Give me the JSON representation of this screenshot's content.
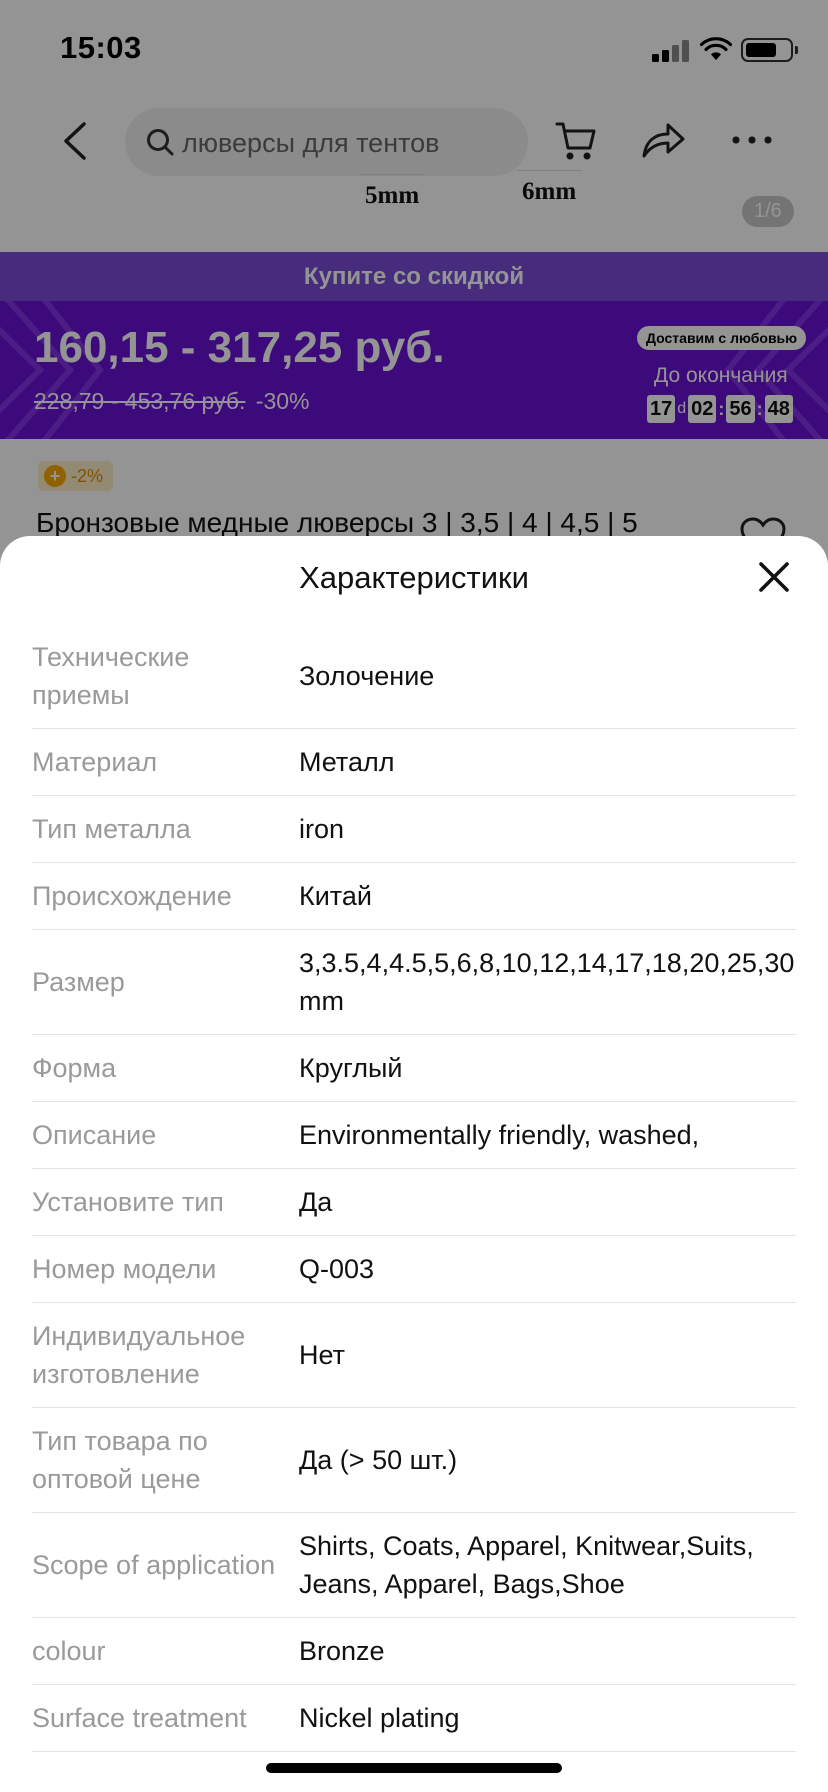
{
  "status_bar": {
    "time": "15:03",
    "battery_level": 0.72
  },
  "nav": {
    "search_text": "люверсы для тентов"
  },
  "gallery": {
    "size_labels": [
      "5mm",
      "6mm"
    ],
    "counter": "1/6"
  },
  "promo": {
    "banner": "Купите со скидкой",
    "price_range": "160,15 - 317,25 руб.",
    "old_price": "228,79 - 453,76 руб.",
    "discount": "-30%",
    "badge": "Доставим с любовью",
    "ends_label": "До окончания",
    "timer": {
      "days": "17",
      "days_unit": "d",
      "hours": "02",
      "minutes": "56",
      "seconds": "48"
    },
    "background_color": "#6a12d6",
    "strip_color": "#7b4bd8"
  },
  "product": {
    "coin_badge": "-2%",
    "title": "Бронзовые медные люверсы 3 | 3,5 | 4 | 4,5 | 5"
  },
  "sheet": {
    "title": "Характеристики",
    "specs": [
      {
        "key": "Технические приемы",
        "value": "Золочение"
      },
      {
        "key": "Материал",
        "value": "Металл"
      },
      {
        "key": "Тип металла",
        "value": "iron"
      },
      {
        "key": "Происхождение",
        "value": "Китай"
      },
      {
        "key": "Размер",
        "value": "3,3.5,4,4.5,5,6,8,10,12,14,17,18,20,25,30 mm"
      },
      {
        "key": "Форма",
        "value": "Круглый"
      },
      {
        "key": "Описание",
        "value": "Environmentally friendly, washed,"
      },
      {
        "key": "Установите тип",
        "value": "Да"
      },
      {
        "key": "Номер модели",
        "value": "Q-003"
      },
      {
        "key": "Индивидуальное изготовление",
        "value": "Нет"
      },
      {
        "key": "Тип товара по оптовой цене",
        "value": "Да (> 50 шт.)"
      },
      {
        "key": "Scope of application",
        "value": "Shirts, Coats, Apparel, Knitwear,Suits, Jeans, Apparel, Bags,Shoe"
      },
      {
        "key": "colour",
        "value": "Bronze"
      },
      {
        "key": "Surface treatment",
        "value": "Nickel plating"
      }
    ]
  }
}
